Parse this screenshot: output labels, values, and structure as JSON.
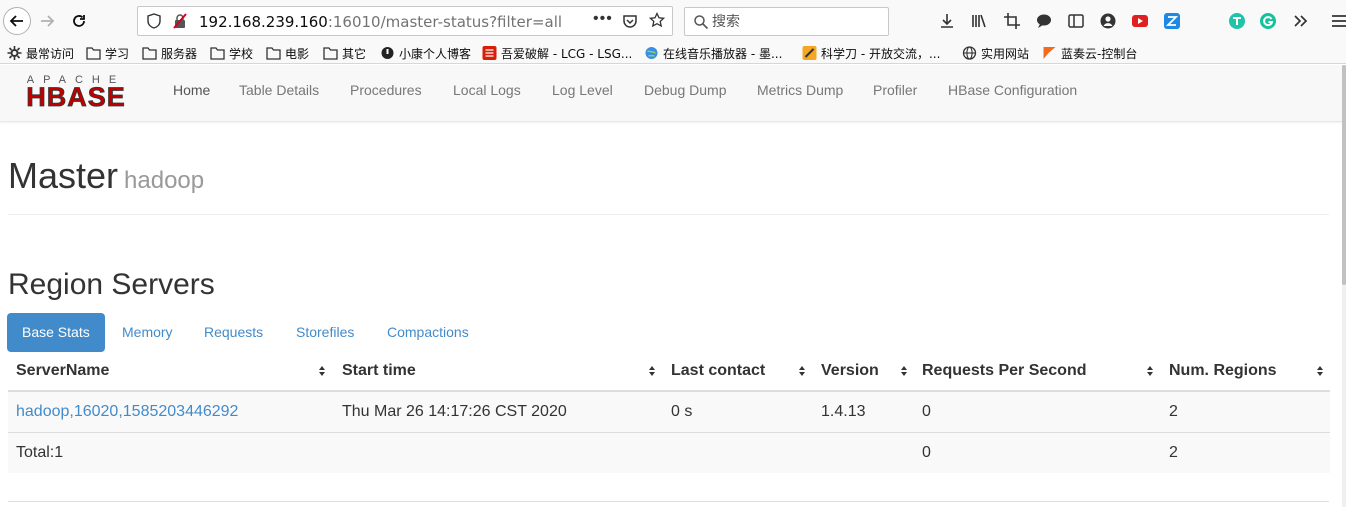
{
  "browser": {
    "url_main": "192.168.239.160",
    "url_rest": ":16010/master-status?filter=all",
    "search_placeholder": "搜索",
    "more_dots": "•••",
    "bookmarks": [
      {
        "label": "最常访问",
        "icon": "gear-icon"
      },
      {
        "label": "学习",
        "icon": "folder-icon"
      },
      {
        "label": "服务器",
        "icon": "folder-icon"
      },
      {
        "label": "学校",
        "icon": "folder-icon"
      },
      {
        "label": "电影",
        "icon": "folder-icon"
      },
      {
        "label": "其它",
        "icon": "folder-icon"
      },
      {
        "label": "小康个人博客",
        "icon": "site-icon"
      },
      {
        "label": "吾爱破解 - LCG - LSG...",
        "icon": "site-icon"
      },
      {
        "label": "在线音乐播放器 - 墨...",
        "icon": "site-icon"
      },
      {
        "label": "科学刀 - 开放交流，...",
        "icon": "site-icon"
      },
      {
        "label": "实用网站",
        "icon": "globe-icon"
      },
      {
        "label": "蓝奏云-控制台",
        "icon": "site-icon"
      }
    ]
  },
  "app": {
    "logo_top": "APACHE",
    "logo_main": "HBASE",
    "nav": [
      "Home",
      "Table Details",
      "Procedures",
      "Local Logs",
      "Log Level",
      "Debug Dump",
      "Metrics Dump",
      "Profiler",
      "HBase Configuration"
    ],
    "title": "Master",
    "subtitle": "hadoop",
    "section": "Region Servers",
    "tabs": [
      "Base Stats",
      "Memory",
      "Requests",
      "Storefiles",
      "Compactions"
    ],
    "active_tab": "Base Stats",
    "table": {
      "headers": [
        "ServerName",
        "Start time",
        "Last contact",
        "Version",
        "Requests Per Second",
        "Num. Regions"
      ],
      "rows": [
        [
          "hadoop,16020,1585203446292",
          "Thu Mar 26 14:17:26 CST 2020",
          "0 s",
          "1.4.13",
          "0",
          "2"
        ]
      ],
      "total": [
        "Total:1",
        "",
        "",
        "",
        "0",
        "2"
      ]
    }
  },
  "colors": {
    "link": "#428bca",
    "logo_red": "#c00000"
  }
}
